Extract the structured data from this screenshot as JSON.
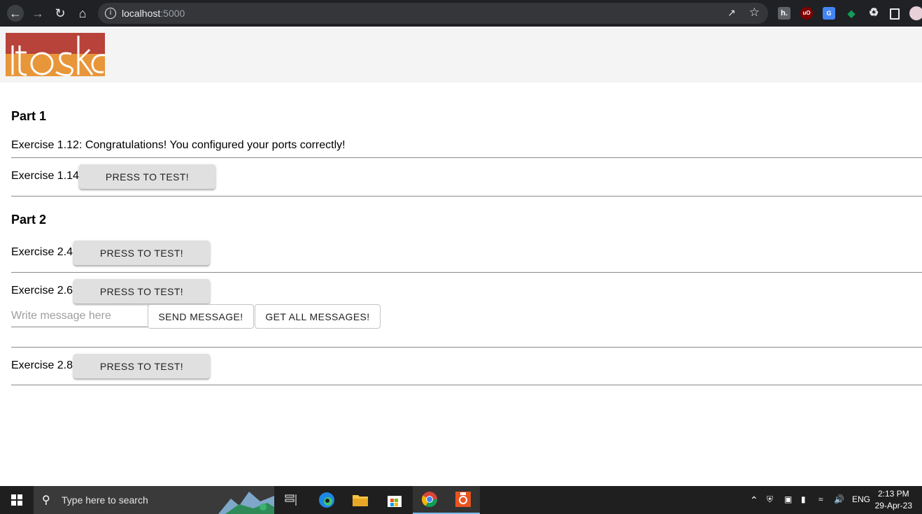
{
  "browser": {
    "url_host": "localhost",
    "url_port": ":5000"
  },
  "header": {
    "logo_text": "toska"
  },
  "part1": {
    "title": "Part 1",
    "ex112_text": "Exercise 1.12: Congratulations! You configured your ports correctly!",
    "ex114_label": "Exercise 1.14:",
    "ex114_button": "PRESS TO TEST!"
  },
  "part2": {
    "title": "Part 2",
    "ex24_label": "Exercise 2.4:",
    "ex24_button": "PRESS TO TEST!",
    "ex26_label": "Exercise 2.6:",
    "ex26_button": "PRESS TO TEST!",
    "message_placeholder": "Write message here",
    "send_button": "SEND MESSAGE!",
    "get_all_button": "GET ALL MESSAGES!",
    "ex28_label": "Exercise 2.8:",
    "ex28_button": "PRESS TO TEST!"
  },
  "taskbar": {
    "search_placeholder": "Type here to search",
    "language": "ENG",
    "time": "2:13 PM",
    "date": "29-Apr-23"
  },
  "colors": {
    "logo_red": "#b8433a",
    "logo_orange": "#e8963a",
    "header_bg": "#f4f4f4",
    "button_bg": "#e0e0e0"
  }
}
